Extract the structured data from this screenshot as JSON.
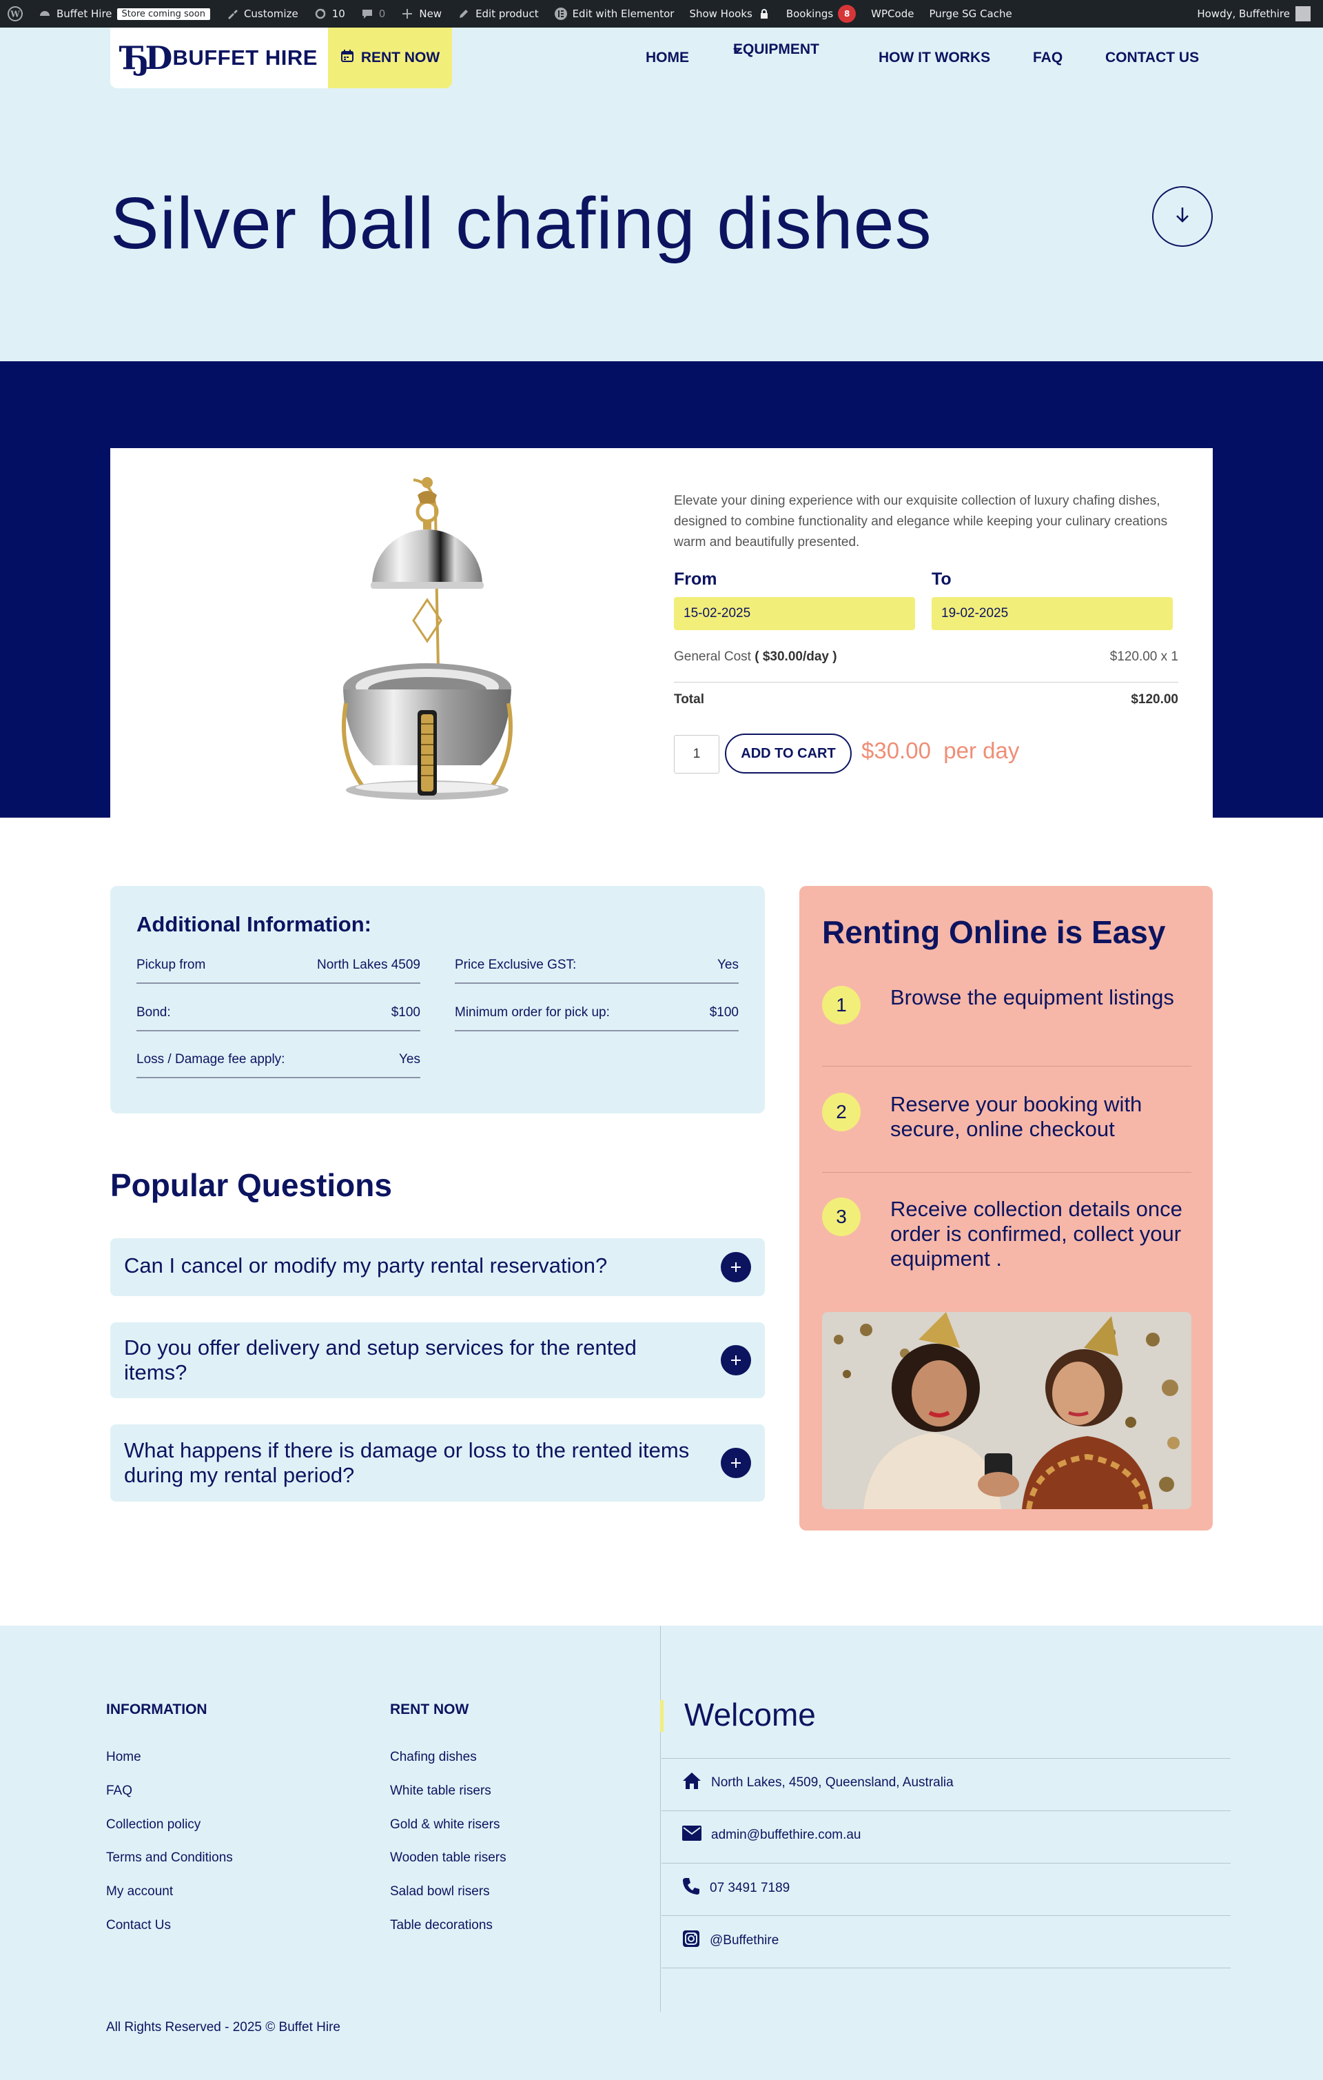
{
  "admin_bar": {
    "site_name": "Buffet Hire",
    "store_badge": "Store coming soon",
    "customize": "Customize",
    "updates_count": "10",
    "comments_count": "0",
    "new": "New",
    "edit_product": "Edit product",
    "edit_elementor": "Edit with Elementor",
    "show_hooks": "Show Hooks",
    "bookings": "Bookings",
    "bookings_count": "8",
    "wpcode": "WPCode",
    "purge_cache": "Purge SG Cache",
    "howdy": "Howdy, Buffethire"
  },
  "header": {
    "logo_text": "BUFFET HIRE",
    "rent_now": "RENT NOW",
    "nav": {
      "home": "HOME",
      "equipment": "EQUIPMENT",
      "how_it_works": "HOW IT WORKS",
      "faq": "FAQ",
      "contact": "CONTACT US"
    }
  },
  "hero": {
    "title": "Silver ball chafing dishes"
  },
  "product": {
    "description": "Elevate your dining experience with our exquisite collection of luxury chafing dishes, designed to combine functionality and elegance while keeping your culinary creations warm and beautifully presented.",
    "from_label": "From",
    "to_label": "To",
    "from_date": "15-02-2025",
    "to_date": "19-02-2025",
    "general_cost_label": "General Cost",
    "general_cost_rate": "( $30.00/day )",
    "general_cost_value": "$120.00 x 1",
    "total_label": "Total",
    "total_value": "$120.00",
    "quantity": "1",
    "add_to_cart": "ADD TO CART",
    "price": "$30.00",
    "price_unit": "per day"
  },
  "additional_info": {
    "title": "Additional Information:",
    "rows": [
      {
        "label": "Pickup from",
        "value": "North Lakes 4509"
      },
      {
        "label": "Price Exclusive GST:",
        "value": "Yes"
      },
      {
        "label": "Bond:",
        "value": "$100"
      },
      {
        "label": "Minimum order for pick up:",
        "value": "$100"
      },
      {
        "label": "Loss / Damage fee apply:",
        "value": "Yes"
      }
    ]
  },
  "faq": {
    "title": "Popular Questions",
    "items": [
      "Can I cancel or modify my party rental reservation?",
      "Do you offer delivery and setup services for the rented items?",
      "What happens if there is damage or loss to the rented items during my rental period?"
    ]
  },
  "renting": {
    "title": "Renting Online is Easy",
    "steps": [
      {
        "num": "1",
        "text": "Browse the equipment listings"
      },
      {
        "num": "2",
        "text": "Reserve your booking with secure, online checkout"
      },
      {
        "num": "3",
        "text": "Receive collection details once order is confirmed, collect your equipment ."
      }
    ]
  },
  "footer": {
    "info_heading": "INFORMATION",
    "info_links": [
      "Home",
      "FAQ",
      "Collection policy",
      "Terms and Conditions",
      "My account",
      "Contact Us"
    ],
    "rent_heading": "RENT NOW",
    "rent_links": [
      "Chafing dishes",
      "White table risers",
      "Gold & white risers",
      "Wooden table risers",
      "Salad bowl risers",
      "Table decorations"
    ],
    "welcome": "Welcome",
    "address": "North Lakes, 4509, Queensland, Australia",
    "email": "admin@buffethire.com.au",
    "phone": "07 3491 7189",
    "instagram": "@Buffethire",
    "copyright": "All Rights Reserved - 2025 © Buffet Hire"
  },
  "colors": {
    "navy": "#0c1460",
    "band": "#030f63",
    "light_blue": "#dff1f6",
    "yellow": "#f2ee7a",
    "salmon": "#f6b7a8",
    "price": "#ef8e77"
  }
}
